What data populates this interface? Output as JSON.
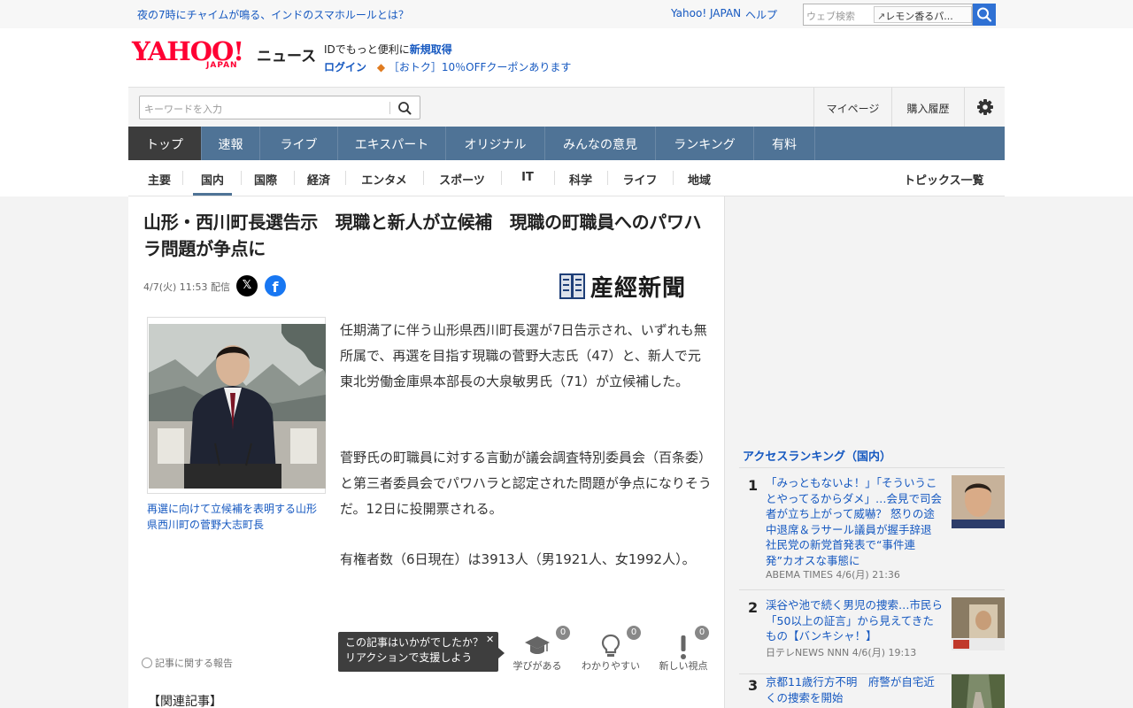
{
  "topbar": {
    "headline": "夜の7時にチャイムが鳴る、インドのスマホルールとは？",
    "yahoo_japan": "Yahoo! JAPAN",
    "help": "ヘルプ",
    "web_search_placeholder": "ウェブ検索",
    "web_search_suggest": "レモン香るパ..."
  },
  "header": {
    "logo_yahoo": "YAHOO!",
    "logo_japan": "JAPAN",
    "logo_news": "ニュース",
    "promo_text": "IDでもっと便利に",
    "promo_link": "新規取得",
    "login": "ログイン",
    "coupon": "［おトク］10％OFFクーポンあります"
  },
  "searchbar": {
    "placeholder": "キーワードを入力",
    "mypage": "マイページ",
    "history": "購入履歴"
  },
  "mainnav": [
    "トップ",
    "速報",
    "ライブ",
    "エキスパート",
    "オリジナル",
    "みんなの意見",
    "ランキング",
    "有料"
  ],
  "subnav": {
    "items": [
      "主要",
      "国内",
      "国際",
      "経済",
      "エンタメ",
      "スポーツ",
      "IT",
      "科学",
      "ライフ",
      "地域"
    ],
    "active": "国内",
    "topics": "トピックス一覧"
  },
  "article": {
    "headline": "山形・西川町長選告示　現職と新人が立候補　現職の町職員へのパワハラ問題が争点に",
    "date": "4/7(火) 11:53 配信",
    "source": "産經新聞",
    "caption": "再選に向けて立候補を表明する山形県西川町の菅野大志町長",
    "paragraphs": [
      "任期満了に伴う山形県西川町長選が7日告示され、いずれも無所属で、再選を目指す現職の菅野大志氏（47）と、新人で元東北労働金庫県本部長の大泉敏男氏（71）が立候補した。",
      "菅野氏の町職員に対する言動が議会調査特別委員会（百条委）と第三者委員会でパワハラと認定された問題が争点になりそうだ。12日に投開票される。",
      "有権者数（6日現在）は3913人（男1921人、女1992人）。"
    ],
    "report": "記事に関する報告",
    "tooltip_line1": "この記事はいかがでしたか？",
    "tooltip_line2": "リアクションで支援しよう",
    "reactions": [
      {
        "label": "学びがある",
        "count": "0",
        "icon": "graduation-cap-icon"
      },
      {
        "label": "わかりやすい",
        "count": "0",
        "icon": "lightbulb-icon"
      },
      {
        "label": "新しい視点",
        "count": "0",
        "icon": "exclamation-icon"
      }
    ],
    "related": "【関連記事】"
  },
  "ranking": {
    "title": "アクセスランキング（国内）",
    "items": [
      {
        "rank": "1",
        "title": "「みっともないよ！」「そういうことやってるからダメ」…会見で司会者が立ち上がって威嚇？ 怒りの途中退席＆ラサール議員が握手辞退 社民党の新党首発表で“事件連発”カオスな事態に",
        "meta": "ABEMA TIMES 4/6(月) 21:36"
      },
      {
        "rank": "2",
        "title": "渓谷や池で続く男児の捜索…市民ら「50以上の証言」から見えてきたもの【バンキシャ！】",
        "meta": "日テレNEWS NNN 4/6(月) 19:13"
      },
      {
        "rank": "3",
        "title": "京都11歳行方不明　府警が自宅近くの捜索を開始",
        "meta": ""
      }
    ]
  },
  "colors": {
    "nav_bg": "#4f7396",
    "nav_active": "#3c3c3c",
    "link": "#1558c0",
    "brand_red": "#ff0033"
  }
}
